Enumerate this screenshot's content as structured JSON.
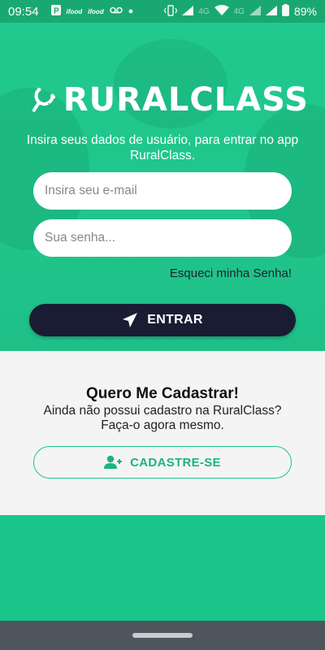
{
  "status_bar": {
    "time": "09:54",
    "icons_left": [
      "parking-icon",
      "ifood-icon",
      "ifood-icon",
      "voicemail-icon",
      "dot-icon"
    ],
    "ifood_label": "ifood",
    "network_label_1": "4G",
    "network_label_2": "4G",
    "battery": "89%"
  },
  "app": {
    "name": "RURALCLASS",
    "colors": {
      "primary": "#1bc68c",
      "dark": "#1a1c33",
      "light_bg": "#f4f4f4"
    }
  },
  "login": {
    "intro": "Insira seus dados de usuário, para entrar no app RuralClass.",
    "email_placeholder": "Insira seu e-mail",
    "email_value": "",
    "password_placeholder": "Sua senha...",
    "password_value": "",
    "forgot_label": "Esqueci minha Senha!",
    "enter_label": "ENTRAR",
    "enter_icon": "send-icon"
  },
  "signup": {
    "title": "Quero Me Cadastrar!",
    "line1": "Ainda não possui cadastro na RuralClass?",
    "line2": "Faça-o agora mesmo.",
    "button_label": "CADASTRE-SE",
    "button_icon": "user-plus-icon"
  }
}
